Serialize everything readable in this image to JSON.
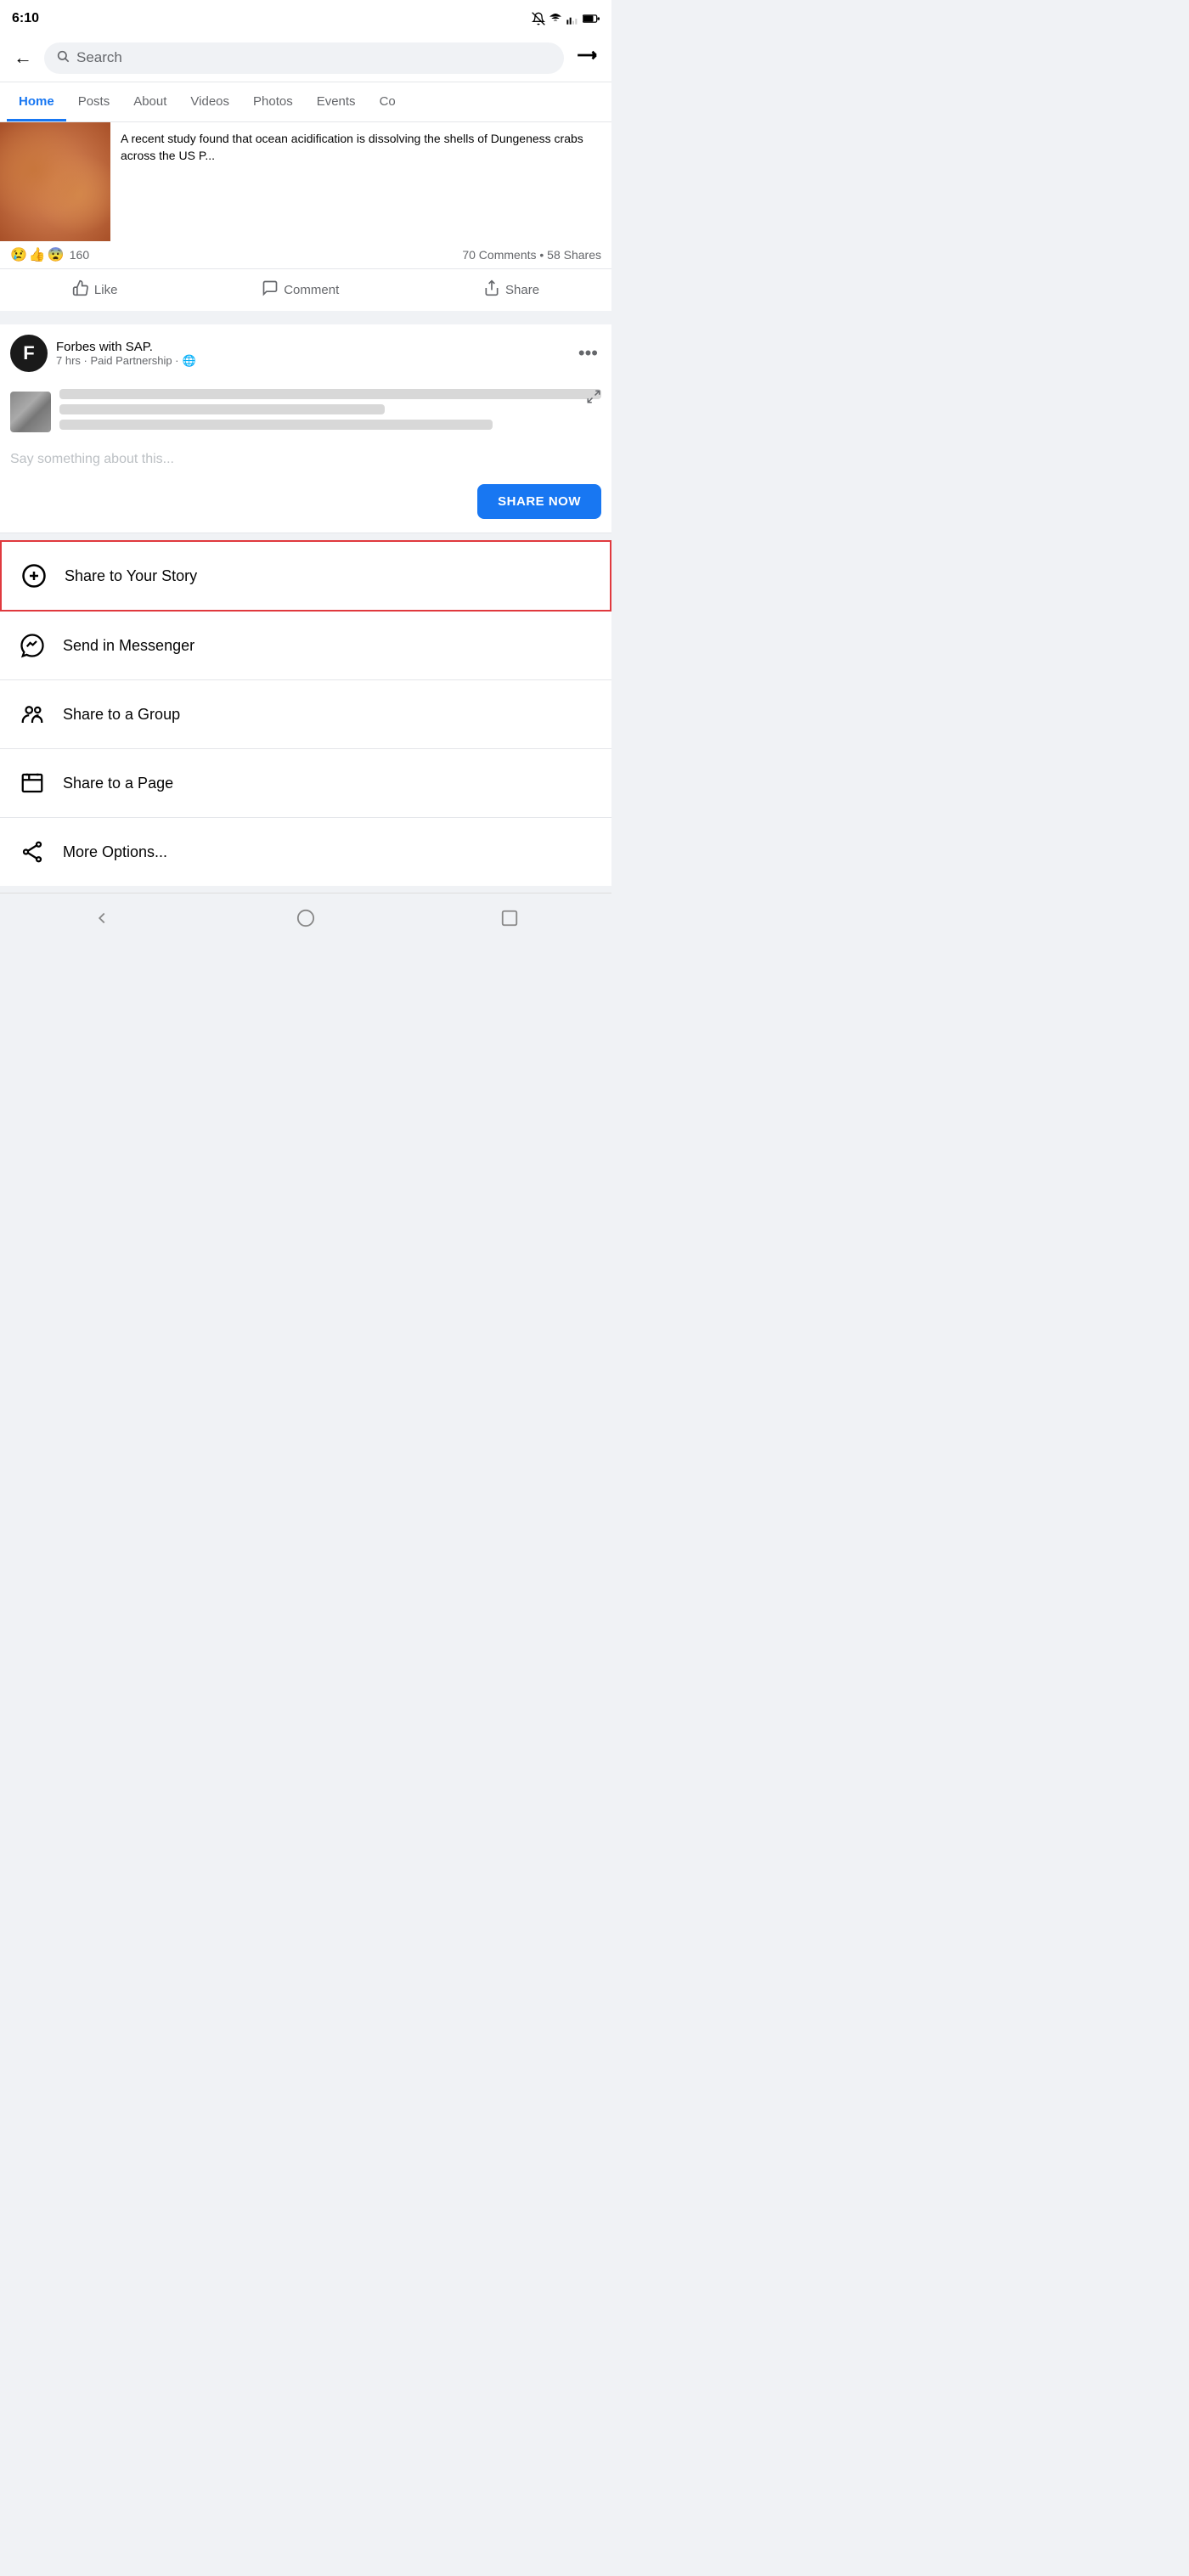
{
  "statusBar": {
    "time": "6:10",
    "icons": "● ◉ ◎ B ◉ ✣ ♩ ◉ ◉ ◉ · 🔕 ▼ ◁ ▲ 🔋"
  },
  "topNav": {
    "backLabel": "←",
    "searchPlaceholder": "Search",
    "shareLabel": "↪"
  },
  "tabs": [
    {
      "label": "Home",
      "active": true
    },
    {
      "label": "Posts",
      "active": false
    },
    {
      "label": "About",
      "active": false
    },
    {
      "label": "Videos",
      "active": false
    },
    {
      "label": "Photos",
      "active": false
    },
    {
      "label": "Events",
      "active": false
    },
    {
      "label": "Co",
      "active": false
    }
  ],
  "crabPost": {
    "text": "A recent study found that ocean acidification is dissolving the shells of Dungeness crabs across the US P...",
    "reactions": {
      "emojis": [
        "😢",
        "👍",
        "😨"
      ],
      "count": "160"
    },
    "engagement": "70 Comments • 58 Shares"
  },
  "actionButtons": [
    {
      "label": "Like",
      "icon": "👍"
    },
    {
      "label": "Comment",
      "icon": "💬"
    },
    {
      "label": "Share",
      "icon": "↗"
    }
  ],
  "forbesPost": {
    "name": "Forbes",
    "withLabel": "with",
    "partner": "SAP.",
    "meta": "7 hrs · Paid Partnership ·",
    "globeIcon": "🌐"
  },
  "shareSheet": {
    "sayPlaceholder": "Say something about this...",
    "shareNowBtn": "SHARE NOW"
  },
  "shareOptions": [
    {
      "id": "share-story",
      "label": "Share to Your Story",
      "highlighted": true
    },
    {
      "id": "send-messenger",
      "label": "Send in Messenger",
      "highlighted": false
    },
    {
      "id": "share-group",
      "label": "Share to a Group",
      "highlighted": false
    },
    {
      "id": "share-page",
      "label": "Share to a Page",
      "highlighted": false
    },
    {
      "id": "more-options",
      "label": "More Options...",
      "highlighted": false
    }
  ],
  "bottomNav": {
    "back": "◁",
    "home": "○",
    "recent": "□"
  }
}
